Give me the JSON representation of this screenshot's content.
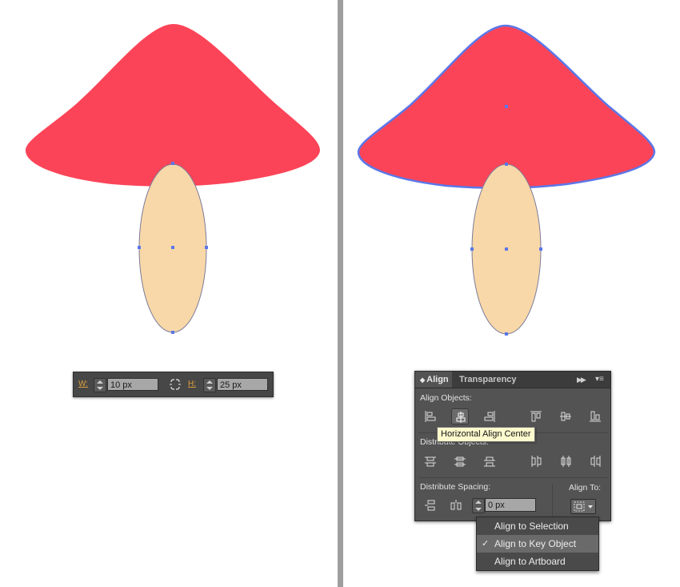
{
  "wh_bar": {
    "w_label": "W:",
    "w_value": "10 px",
    "h_label": "H:",
    "h_value": "25 px"
  },
  "align_panel": {
    "tab_align": "Align",
    "tab_transparency": "Transparency",
    "align_objects_label": "Align Objects:",
    "distribute_objects_label": "Distribute Objects:",
    "distribute_spacing_label": "Distribute Spacing:",
    "align_to_label": "Align To:",
    "spacing_value": "0 px",
    "tooltip": "Horizontal Align Center"
  },
  "align_to_menu": {
    "items": [
      {
        "label": "Align to Selection",
        "checked": false
      },
      {
        "label": "Align to Key Object",
        "checked": true
      },
      {
        "label": "Align to Artboard",
        "checked": false
      }
    ],
    "checkmark": "✓"
  },
  "colors": {
    "cap": "#fc4458",
    "stem": "#f8d8a8",
    "selection": "#5b77e8",
    "panel": "#535353",
    "label_accent": "#e0a23c"
  }
}
